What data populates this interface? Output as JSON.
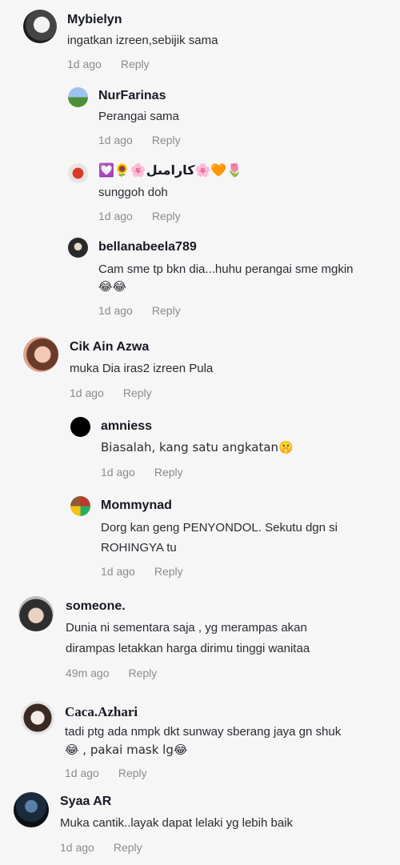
{
  "comments": [
    {
      "username": "Mybielyn",
      "text": "ingatkan izreen,sebijik sama",
      "time": "1d ago",
      "reply": "Reply"
    },
    {
      "username": "NurFarinas",
      "text": "Perangai sama",
      "time": "1d ago",
      "reply": "Reply"
    },
    {
      "username": "💟🌻🌸كارامىل🌸🧡🌷",
      "text": "sunggoh doh",
      "time": "1d ago",
      "reply": "Reply"
    },
    {
      "username": "bellanabeela789",
      "text1": "Cam sme tp bkn dia...huhu perangai sme mgkin",
      "text2": "😂😂",
      "time": "1d ago",
      "reply": "Reply"
    },
    {
      "username": "Cik Ain Azwa",
      "text": "muka Dia iras2 izreen Pula",
      "time": "1d ago",
      "reply": "Reply"
    },
    {
      "username": "amniess",
      "text": "Biasalah, kang satu angkatan🤫",
      "time": "1d ago",
      "reply": "Reply"
    },
    {
      "username": "Mommynad",
      "text1": "Dorg kan geng PENYONDOL. Sekutu dgn si",
      "text2": "ROHINGYA tu",
      "time": "1d ago",
      "reply": "Reply"
    },
    {
      "username": "someone.",
      "text1": "Dunia ni sementara saja , yg merampas akan",
      "text2": "dirampas letakkan harga dirimu tinggi wanitaa",
      "time": "49m ago",
      "reply": "Reply"
    },
    {
      "username": "Caca.Azhari",
      "text1": "tadi ptg ada nmpk dkt sunway sberang jaya gn shuk",
      "text2": "😂 , pakai mask lg😂",
      "time": "1d ago",
      "reply": "Reply"
    },
    {
      "username": "Syaa AR",
      "text": "Muka cantik..layak dapat lelaki yg lebih baik",
      "time": "1d ago",
      "reply": "Reply"
    }
  ]
}
